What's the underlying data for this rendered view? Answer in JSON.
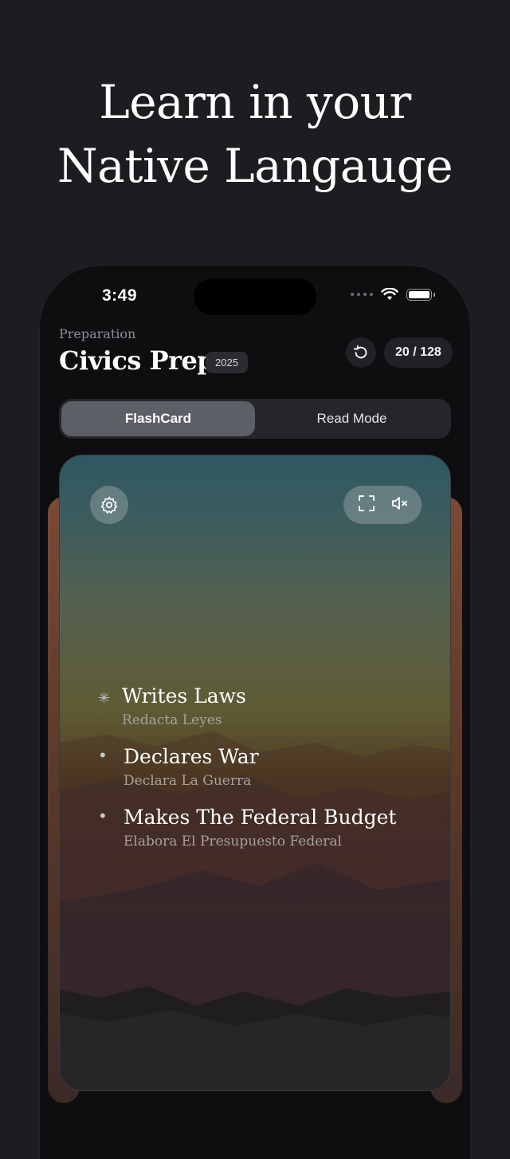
{
  "headline": {
    "line1": "Learn in your",
    "line2": "Native Langauge"
  },
  "status_bar": {
    "time": "3:49"
  },
  "header": {
    "kicker": "Preparation",
    "title": "Civics Prep",
    "year_badge": "2025",
    "counter": "20 / 128"
  },
  "mode_switch": {
    "options": [
      "FlashCard",
      "Read Mode"
    ],
    "selected": "FlashCard"
  },
  "card": {
    "items": [
      {
        "english": "Writes Laws",
        "translation": "Redacta Leyes",
        "marker": "✳"
      },
      {
        "english": "Declares War",
        "translation": "Declara La Guerra",
        "marker": "•"
      },
      {
        "english": "Makes The Federal Budget",
        "translation": "Elabora El Presupuesto Federal",
        "marker": "•"
      }
    ]
  },
  "icons": [
    "reset-icon",
    "gear-icon",
    "fullscreen-icon",
    "mute-icon",
    "wifi-icon",
    "battery-icon"
  ]
}
